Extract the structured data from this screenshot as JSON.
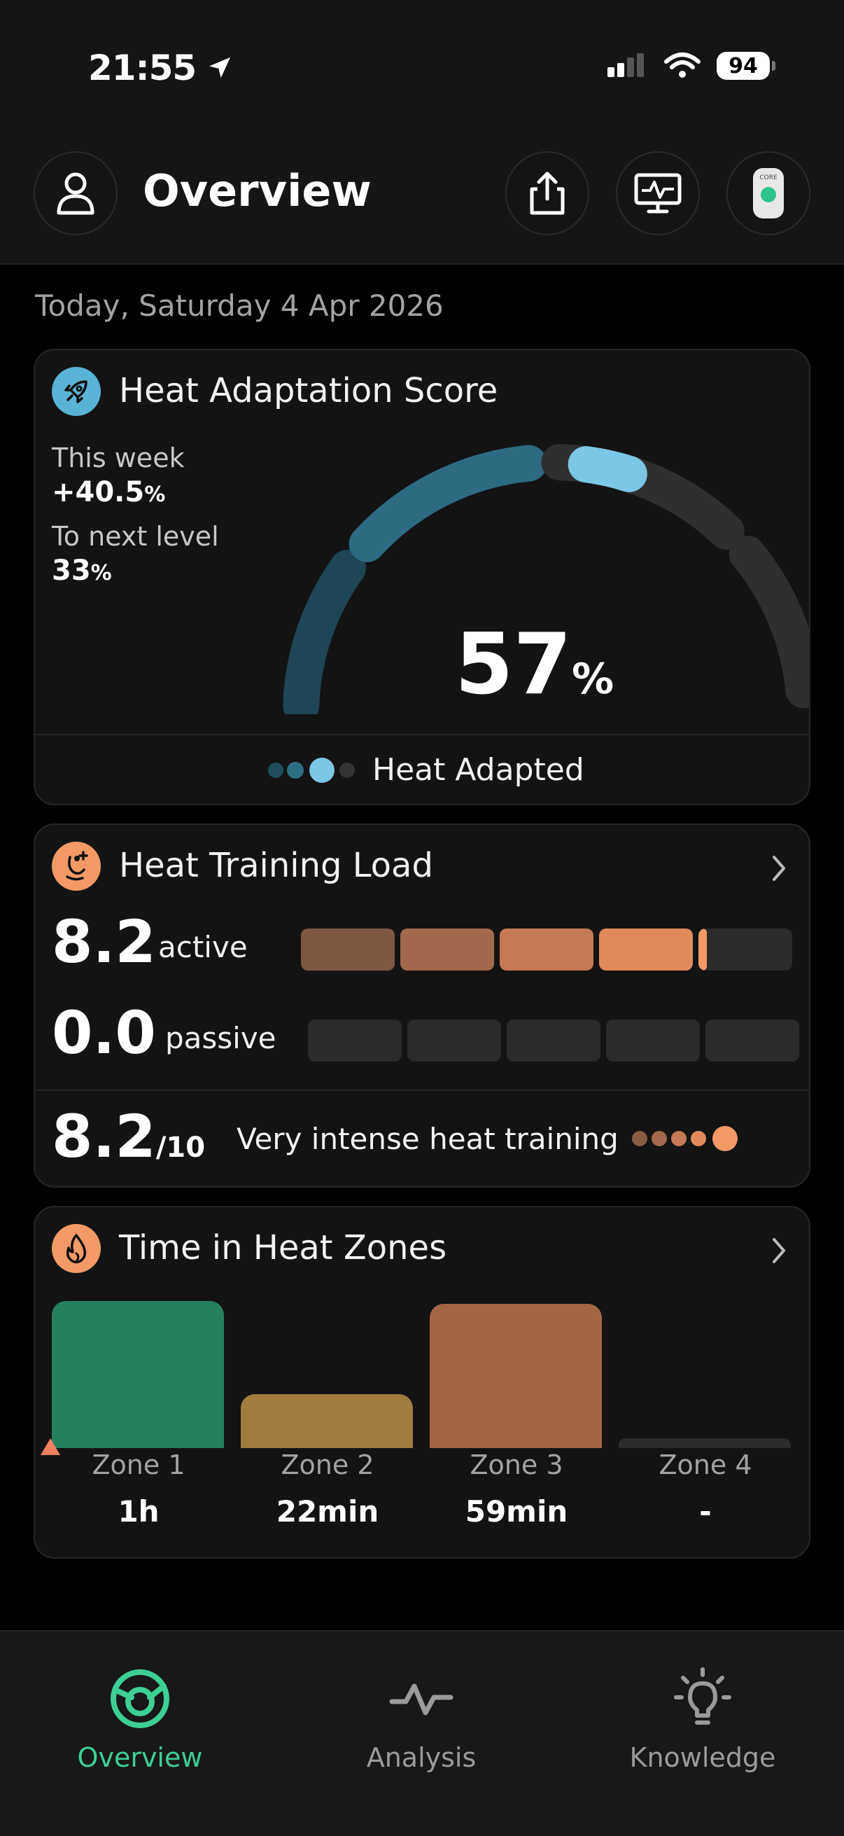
{
  "status_bar": {
    "time": "21:55",
    "battery": "94"
  },
  "header": {
    "title": "Overview"
  },
  "date": "Today, Saturday 4 Apr 2026",
  "heat_adaptation": {
    "title": "Heat Adaptation Score",
    "this_week_label": "This week",
    "this_week_value": "+40.5",
    "next_level_label": "To next level",
    "next_level_value": "33",
    "score": "57",
    "score_fraction": 0.57,
    "percent": "%",
    "status": "Heat Adapted",
    "level_dots": 4,
    "active_dot": 3
  },
  "heat_training_load": {
    "title": "Heat Training Load",
    "active_value": "8.2",
    "active_label": "active",
    "passive_value": "0.0",
    "passive_label": "passive",
    "active_fraction": 0.82,
    "passive_fraction": 0.0,
    "total_value": "8.2",
    "total_max": "/10",
    "description": "Very intense heat training"
  },
  "heat_zones": {
    "title": "Time in Heat Zones",
    "zones": [
      {
        "name": "Zone 1",
        "value": "1h",
        "minutes": 60,
        "color": "#27805d"
      },
      {
        "name": "Zone 2",
        "value": "22min",
        "minutes": 22,
        "color": "#a07d3f"
      },
      {
        "name": "Zone 3",
        "value": "59min",
        "minutes": 59,
        "color": "#a46645"
      },
      {
        "name": "Zone 4",
        "value": "-",
        "minutes": 0,
        "color": "#2c2c2c"
      }
    ]
  },
  "nav": {
    "overview": "Overview",
    "analysis": "Analysis",
    "knowledge": "Knowledge"
  },
  "colors": {
    "accent": "#3ecf95",
    "heat": "#f29a66",
    "adapt": "#7cc6e6"
  }
}
